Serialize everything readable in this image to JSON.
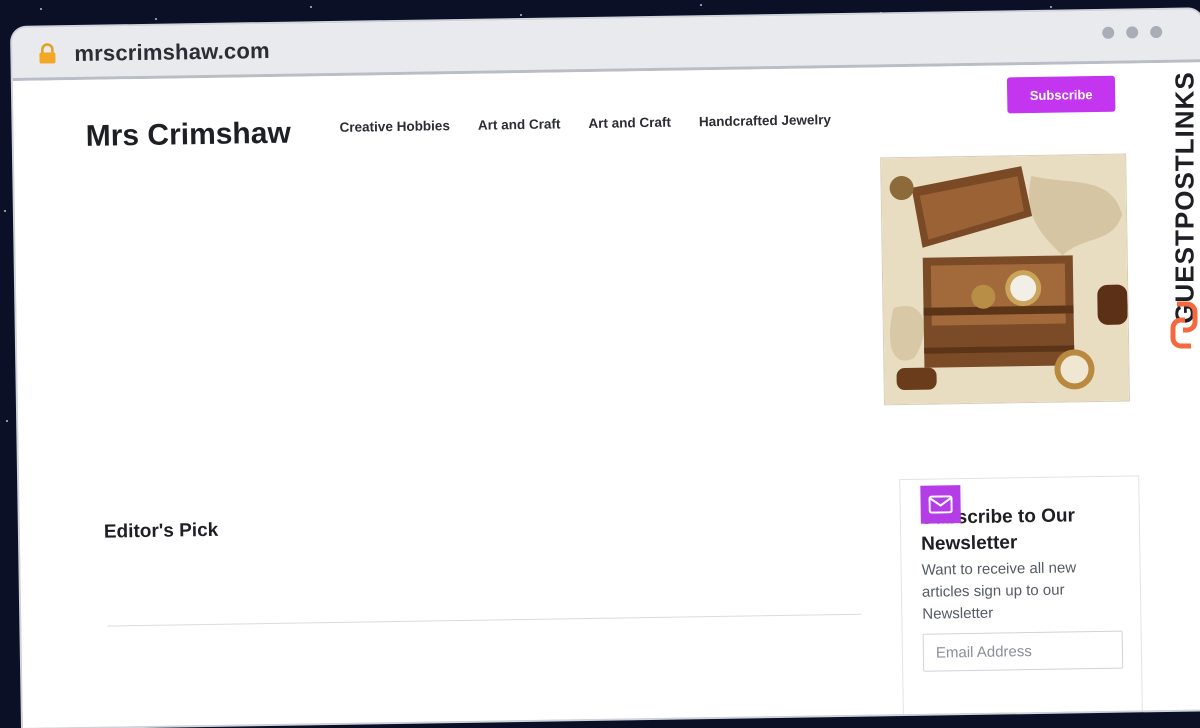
{
  "browser": {
    "url": "mrscrimshaw.com",
    "lock_icon": "lock-icon"
  },
  "site": {
    "title": "Mrs Crimshaw",
    "nav": [
      {
        "label": "Creative Hobbies"
      },
      {
        "label": "Art and Craft"
      },
      {
        "label": "Art and Craft"
      },
      {
        "label": "Handcrafted Jewelry"
      }
    ],
    "subscribe_label": "Subscribe",
    "accent_color": "#c435ef"
  },
  "main": {
    "editors_pick": "Editor's Pick"
  },
  "newsletter": {
    "icon": "mail-icon",
    "title": "Subscribe to Our Newsletter",
    "description": "Want to receive all new articles sign up to our Newsletter",
    "email_placeholder": "Email Address"
  },
  "watermark": {
    "text": "GUESTPOSTLINKS",
    "icon": "link-icon",
    "icon_color": "#f26a3d"
  }
}
